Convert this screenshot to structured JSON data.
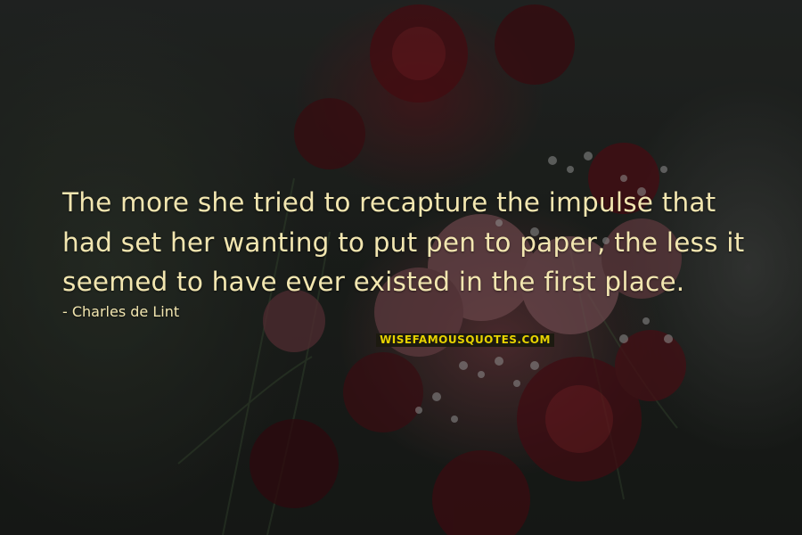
{
  "quote": {
    "lines": [
      "The more she tried to recapture the impulse that",
      "had set her wanting to put pen to paper, the less it",
      "seemed to have ever existed in the first place."
    ],
    "author": "- Charles de Lint"
  },
  "watermark": {
    "text": "WISEFAMOUSQUOTES.COM"
  },
  "colors": {
    "text": "#f2e6b0",
    "logo_text": "#e6d200"
  }
}
